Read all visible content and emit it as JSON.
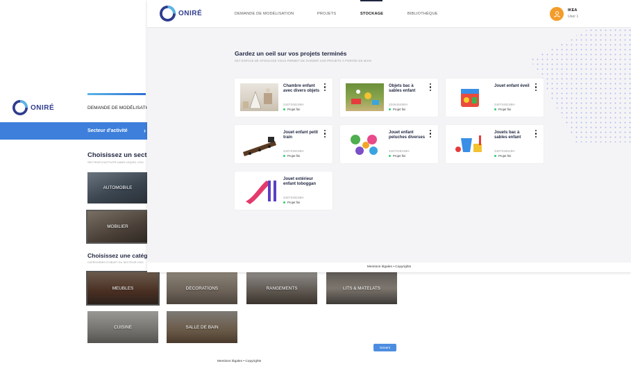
{
  "brand": {
    "name": "ONIRÉ"
  },
  "back_page": {
    "nav_label": "DEMANDE DE MODÉLISATION",
    "sector_tab": "Secteur d'activité",
    "sector_heading": "Choisissez un secteu",
    "sector_sub": "SECTEUR D'ACTIVITÉ DANS LEQUEL VOU",
    "sectors": [
      {
        "label": "AUTOMOBILE"
      },
      {
        "label": "MOBILIER"
      }
    ],
    "category_heading": "Choisissez une catég",
    "category_sub": "CATÉGORIES D'OBJET DU SECTEUR CHO",
    "categories": [
      {
        "label": "MEUBLES"
      },
      {
        "label": "DECORATIONS"
      },
      {
        "label": "RANGEMENTS"
      },
      {
        "label": "LITS & MATELATS"
      },
      {
        "label": "CUISINE"
      },
      {
        "label": "SALLE DE BAIN"
      }
    ],
    "next_button": "Suivant",
    "footer": "Mentions légales • Copyrights"
  },
  "front_page": {
    "nav": [
      {
        "label": "DEMANDE DE MODÉLISATION"
      },
      {
        "label": "PROJETS"
      },
      {
        "label": "STOCKAGE"
      },
      {
        "label": "BIBLIOTHÉQUE"
      }
    ],
    "active_nav": "STOCKAGE",
    "user": {
      "company": "IKEA",
      "role": "User 1"
    },
    "title": "Gardez un oeil sur vos projets terminés",
    "subtitle": "CET ESPACE DE STOCKAGE VOUS PERMET DE GARDER VOS PROJETS À PORTÉE DE MAIN",
    "projects": [
      {
        "name": "Chambre enfant avec divers objets",
        "code": "3487048198H",
        "status": "Projet fini"
      },
      {
        "name": "Objets bac à sables enfant",
        "code": "334948498H",
        "status": "Projet fini"
      },
      {
        "name": "Jouet enfant éveil",
        "code": "3487048198H",
        "status": "Projet fini"
      },
      {
        "name": "Jouet enfant petit train",
        "code": "3487049198H",
        "status": "Projet fini"
      },
      {
        "name": "Jouet enfant peluches diverses",
        "code": "3487048198H",
        "status": "Projet fini"
      },
      {
        "name": "Jouets bac à sables enfant",
        "code": "3487048918H",
        "status": "Projet fini"
      },
      {
        "name": "Jouet extérieur enfant toboggan",
        "code": "3487048198H",
        "status": "Projet fini"
      }
    ],
    "footer": "Mentions légales • Copyrights"
  },
  "colors": {
    "accent": "#3d7fdb",
    "brand_dark": "#2f3c8f",
    "status_ok": "#2ecc71",
    "avatar": "#f39c2a"
  },
  "icons": {
    "user": "user-icon",
    "more": "kebab-menu-icon",
    "chevron": "chevron-right-icon"
  }
}
